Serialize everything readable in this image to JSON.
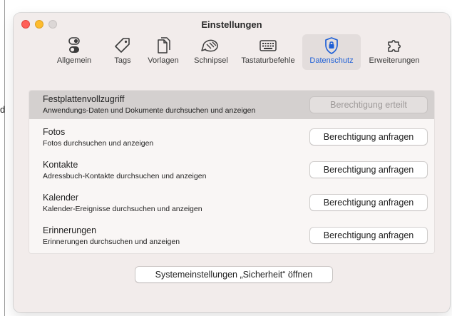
{
  "background": {
    "partial_char": "d"
  },
  "window": {
    "title": "Einstellungen"
  },
  "toolbar": {
    "items": [
      {
        "label": "Allgemein",
        "icon": "switches-icon"
      },
      {
        "label": "Tags",
        "icon": "tag-icon"
      },
      {
        "label": "Vorlagen",
        "icon": "documents-icon"
      },
      {
        "label": "Schnipsel",
        "icon": "snippet-icon"
      },
      {
        "label": "Tastaturbefehle",
        "icon": "keyboard-icon"
      },
      {
        "label": "Datenschutz",
        "icon": "lock-shield-icon",
        "active": true
      },
      {
        "label": "Erweiterungen",
        "icon": "puzzle-icon"
      }
    ],
    "active_color": "#1e5fd6"
  },
  "permissions": {
    "rows": [
      {
        "title": "Festplattenvollzugriff",
        "description": "Anwendungs-Daten und Dokumente durchsuchen und anzeigen",
        "button": "Berechtigung erteilt",
        "granted": true
      },
      {
        "title": "Fotos",
        "description": "Fotos durchsuchen und anzeigen",
        "button": "Berechtigung anfragen",
        "granted": false
      },
      {
        "title": "Kontakte",
        "description": "Adressbuch-Kontakte durchsuchen und anzeigen",
        "button": "Berechtigung anfragen",
        "granted": false
      },
      {
        "title": "Kalender",
        "description": "Kalender-Ereignisse durchsuchen und anzeigen",
        "button": "Berechtigung anfragen",
        "granted": false
      },
      {
        "title": "Erinnerungen",
        "description": "Erinnerungen durchsuchen und anzeigen",
        "button": "Berechtigung anfragen",
        "granted": false
      }
    ]
  },
  "footer": {
    "open_settings_label": "Systemeinstellungen „Sicherheit“ öffnen"
  }
}
